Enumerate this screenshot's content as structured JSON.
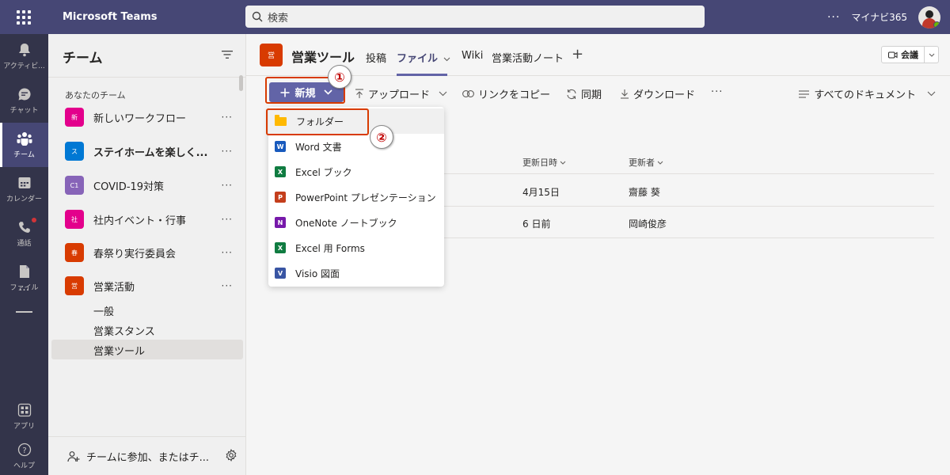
{
  "app": {
    "title": "Microsoft Teams"
  },
  "search": {
    "placeholder": "検索"
  },
  "account": {
    "name": "マイナビ365"
  },
  "rail": {
    "items": [
      {
        "label": "アクティビ..."
      },
      {
        "label": "チャット"
      },
      {
        "label": "チーム"
      },
      {
        "label": "カレンダー"
      },
      {
        "label": "通話"
      },
      {
        "label": "ファイル"
      }
    ],
    "more": "...",
    "apps": "アプリ",
    "help": "ヘルプ"
  },
  "teams_panel": {
    "title": "チーム",
    "section_label": "あなたのチーム",
    "teams": [
      {
        "badge": "新",
        "name": "新しいワークフロー",
        "color": "#e3008c"
      },
      {
        "badge": "ス",
        "name": "ステイホームを楽しく...",
        "color": "#0078d4"
      },
      {
        "badge": "C1",
        "name": "COVID-19対策",
        "color": "#8764b8"
      },
      {
        "badge": "社",
        "name": "社内イベント・行事",
        "color": "#e3008c"
      },
      {
        "badge": "春",
        "name": "春祭り実行委員会",
        "color": "#d83b01"
      },
      {
        "badge": "営",
        "name": "営業活動",
        "color": "#d83b01"
      }
    ],
    "channels": [
      "一般",
      "営業スタンス",
      "営業ツール"
    ],
    "join_label": "チームに参加、またはチ..."
  },
  "channel": {
    "badge": "営",
    "title": "営業ツール",
    "tabs": [
      "投稿",
      "ファイル",
      "Wiki",
      "営業活動ノート"
    ],
    "meeting_label": "会議"
  },
  "toolbar": {
    "new_label": "新規",
    "upload_label": "アップロード",
    "copy_link_label": "リンクをコピー",
    "sync_label": "同期",
    "download_label": "ダウンロード",
    "more": "···",
    "view_label": "すべてのドキュメント"
  },
  "callouts": [
    "①",
    "②"
  ],
  "files_table": {
    "columns": [
      "更新日時",
      "更新者"
    ],
    "rows": [
      {
        "modified": "4月15日",
        "modified_by": "齋藤 葵"
      },
      {
        "modified": "6 日前",
        "modified_by": "岡崎俊彦"
      }
    ]
  },
  "new_menu": {
    "items": [
      {
        "label": "フォルダー",
        "icon": "folder-icon"
      },
      {
        "label": "Word 文書",
        "icon": "word-icon",
        "color": "#185abd",
        "letter": "W"
      },
      {
        "label": "Excel ブック",
        "icon": "excel-icon",
        "color": "#107c41",
        "letter": "X"
      },
      {
        "label": "PowerPoint プレゼンテーション",
        "icon": "powerpoint-icon",
        "color": "#c43e1c",
        "letter": "P"
      },
      {
        "label": "OneNote ノートブック",
        "icon": "onenote-icon",
        "color": "#7719aa",
        "letter": "N"
      },
      {
        "label": "Excel 用 Forms",
        "icon": "forms-icon",
        "color": "#107c41",
        "letter": "X"
      },
      {
        "label": "Visio 図面",
        "icon": "visio-icon",
        "color": "#3955a3",
        "letter": "V"
      }
    ]
  }
}
